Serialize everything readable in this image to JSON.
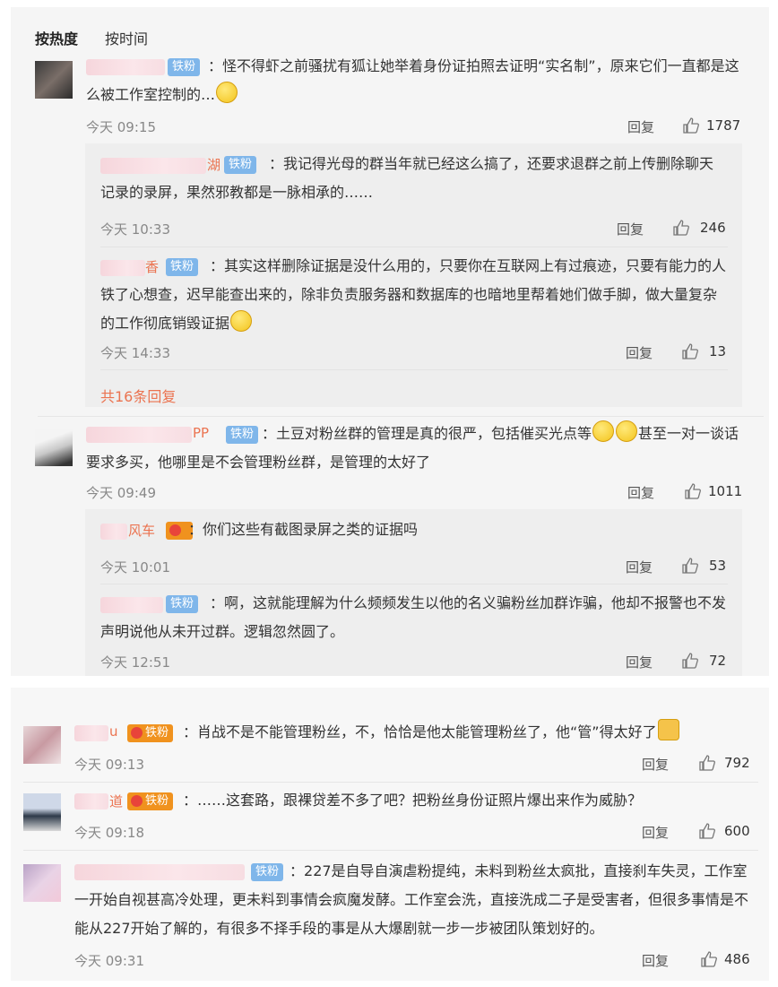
{
  "sort_tabs": {
    "hot": "按热度",
    "time": "按时间"
  },
  "labels": {
    "reply": "回复",
    "badge_tiefen": "铁粉",
    "separator": "："
  },
  "c1": {
    "name_suffix": "",
    "text": "怪不得虾之前骚扰有狐让她举着身份证拍照去证明“实名制”，原来它们一直都是这么被工作室控制的…",
    "time": "今天 09:15",
    "likes": "1787",
    "replies": [
      {
        "name_suffix": "湖",
        "text": "我记得光母的群当年就已经这么搞了，还要求退群之前上传删除聊天记录的录屏，果然邪教都是一脉相承的……",
        "time": "今天 10:33",
        "likes": "246"
      },
      {
        "name_suffix": "香",
        "text": "其实这样删除证据是没什么用的，只要你在互联网上有过痕迹，只要有能力的人铁了心想查，迟早能查出来的，除非负责服务器和数据库的也暗地里帮着她们做手脚，做大量复杂的工作彻底销毁证据",
        "time": "今天 14:33",
        "likes": "13"
      }
    ],
    "more": "共16条回复"
  },
  "c2": {
    "name_suffix": "PP",
    "text": "土豆对粉丝群的管理是真的很严，包括催买光点等",
    "text_after": "甚至一对一谈话要求多买，他哪里是不会管理粉丝群，是管理的太好了",
    "time": "今天 09:49",
    "likes": "1011",
    "replies": [
      {
        "name_suffix": "风车",
        "text": "你们这些有截图录屏之类的证据吗",
        "time": "今天 10:01",
        "likes": "53"
      },
      {
        "name_suffix": "",
        "text": "啊，这就能理解为什么频频发生以他的名义骗粉丝加群诈骗，他却不报警也不发声明说他从未开过群。逻辑忽然圆了。",
        "time": "今天 12:51",
        "likes": "72"
      }
    ]
  },
  "c3": {
    "name_suffix": "u",
    "text": "肖战不是不能管理粉丝，不，恰恰是他太能管理粉丝了，他“管”得太好了",
    "time": "今天 09:13",
    "likes": "792"
  },
  "c4": {
    "name_suffix": "道",
    "text": "……这套路，跟裸贷差不多了吧？把粉丝身份证照片爆出来作为威胁？",
    "time": "今天 09:18",
    "likes": "600"
  },
  "c5": {
    "name_suffix": "",
    "text": "227是自导自演虐粉提纯，未料到粉丝太疯批，直接刹车失灵，工作室一开始自视甚高冷处理，更未料到事情会疯魔发酵。工作室会洗，直接洗成二子是受害者，但很多事情是不能从227开始了解的，有很多不择手段的事是从大爆剧就一步一步被团队策划好的。",
    "time": "今天 09:31",
    "likes": "486"
  },
  "icons": {
    "thumb": "thumb-up-icon",
    "emoji_smile": "smile-emoji-icon",
    "emoji_awkward": "awkward-emoji-icon",
    "emoji_thumb": "thumbs-up-emoji-icon",
    "fan_badge": "fan-badge-icon"
  }
}
